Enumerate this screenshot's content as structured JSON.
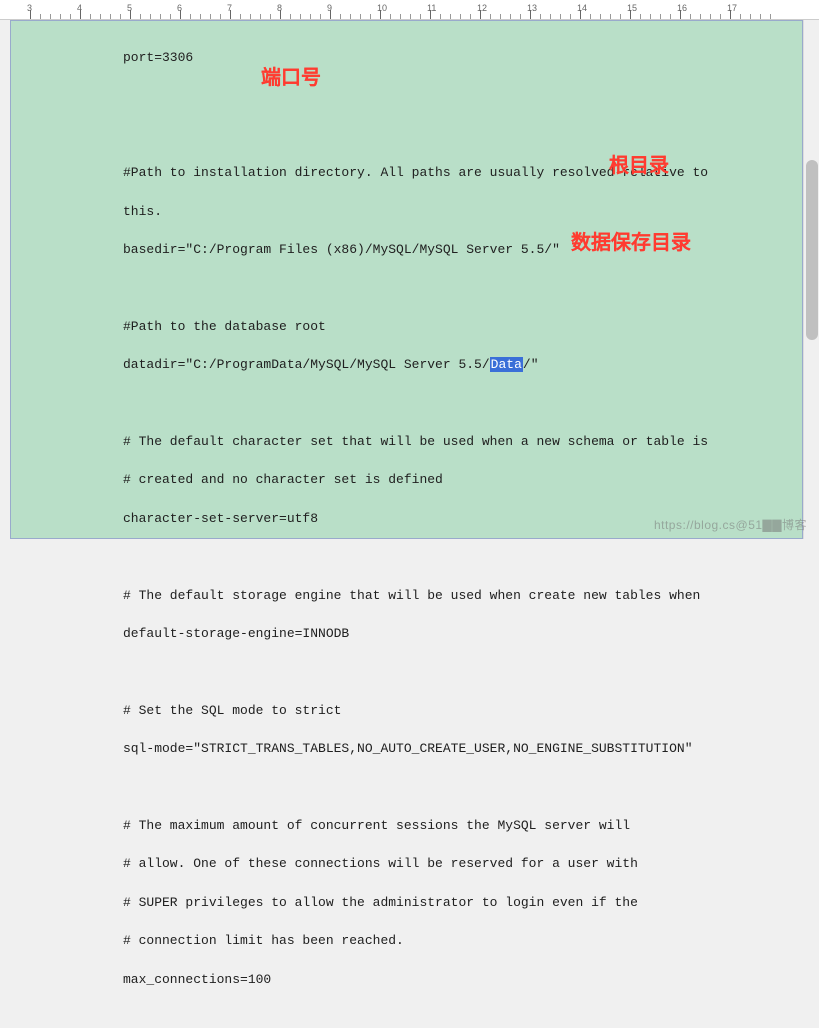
{
  "ruler": {
    "start": 3,
    "end": 17
  },
  "annotations": {
    "port_label": "端口号",
    "root_dir_label": "根目录",
    "data_dir_label": "数据保存目录"
  },
  "selected_text": "Data",
  "code": {
    "l1": "port=3306",
    "l2": "#Path to installation directory. All paths are usually resolved relative to",
    "l3": "this.",
    "l4": "basedir=\"C:/Program Files (x86)/MySQL/MySQL Server 5.5/\"",
    "l5": "#Path to the database root",
    "l6_pre": "datadir=\"C:/ProgramData/MySQL/MySQL Server 5.5/",
    "l6_post": "/\"",
    "l7": "# The default character set that will be used when a new schema or table is",
    "l8": "# created and no character set is defined",
    "l9": "character-set-server=utf8",
    "l10": "# The default storage engine that will be used when create new tables when",
    "l11": "default-storage-engine=INNODB",
    "l12": "# Set the SQL mode to strict",
    "l13": "sql-mode=\"STRICT_TRANS_TABLES,NO_AUTO_CREATE_USER,NO_ENGINE_SUBSTITUTION\"",
    "l14": "# The maximum amount of concurrent sessions the MySQL server will",
    "l15": "# allow. One of these connections will be reserved for a user with",
    "l16": "# SUPER privileges to allow the administrator to login even if the",
    "l17": "# connection limit has been reached.",
    "l18": "max_connections=100"
  },
  "watermark": "https://blog.cs@51▇▇博客"
}
